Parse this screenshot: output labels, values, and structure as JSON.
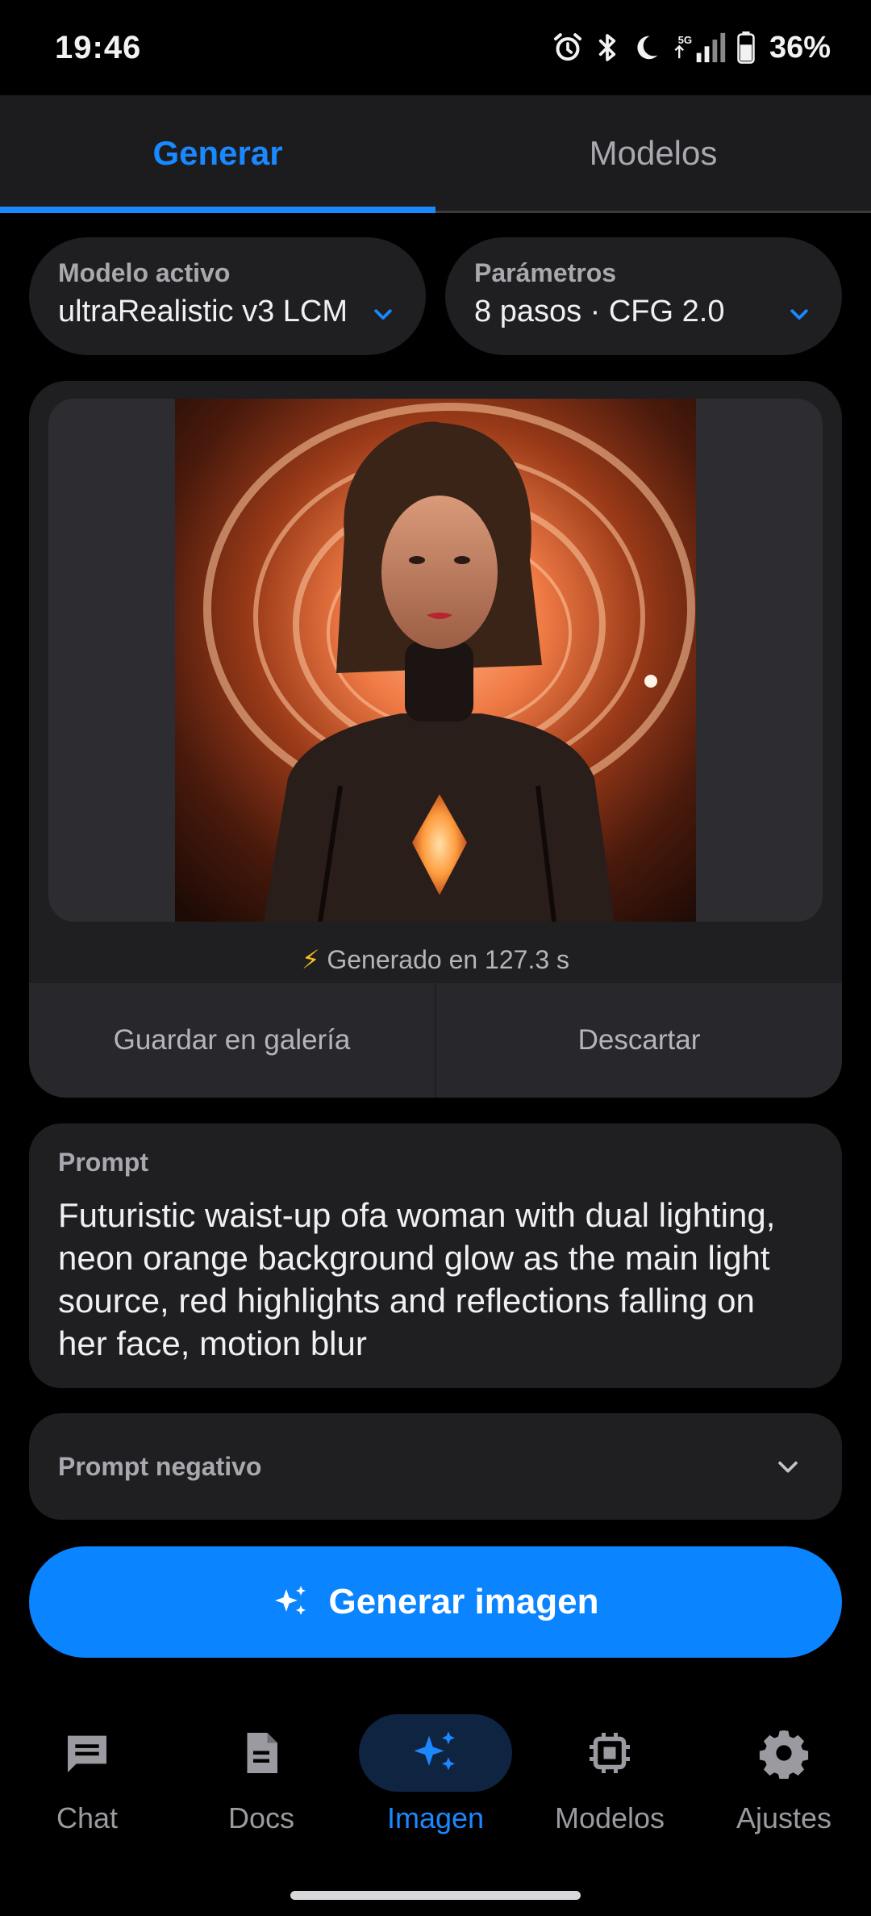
{
  "status_bar": {
    "time": "19:46",
    "battery": "36%",
    "network": "5G",
    "icons": [
      "alarm-icon",
      "bluetooth-icon",
      "moon-icon",
      "signal-icon",
      "battery-icon"
    ]
  },
  "tabs": [
    {
      "label": "Generar",
      "active": true
    },
    {
      "label": "Modelos",
      "active": false
    }
  ],
  "model_selector": {
    "label": "Modelo activo",
    "value": "ultraRealistic v3 LCM"
  },
  "params_selector": {
    "label": "Parámetros",
    "value": "8 pasos · CFG 2.0"
  },
  "result": {
    "generated_text": "Generado en 127.3 s",
    "bolt": "⚡",
    "save_label": "Guardar en galería",
    "discard_label": "Descartar"
  },
  "prompt": {
    "label": "Prompt",
    "text": "Futuristic waist-up ofa woman with dual lighting, neon orange background glow as the main light source, red highlights and reflections falling on her face, motion blur"
  },
  "negative_prompt": {
    "label": "Prompt negativo"
  },
  "generate_button": {
    "label": "Generar imagen"
  },
  "nav": [
    {
      "label": "Chat",
      "icon": "chat-icon",
      "active": false
    },
    {
      "label": "Docs",
      "icon": "document-icon",
      "active": false
    },
    {
      "label": "Imagen",
      "icon": "sparkles-icon",
      "active": true
    },
    {
      "label": "Modelos",
      "icon": "chip-icon",
      "active": false
    },
    {
      "label": "Ajustes",
      "icon": "gear-icon",
      "active": false
    }
  ],
  "colors": {
    "accent": "#0a84ff",
    "background": "#000000",
    "card": "#1f1f22"
  }
}
